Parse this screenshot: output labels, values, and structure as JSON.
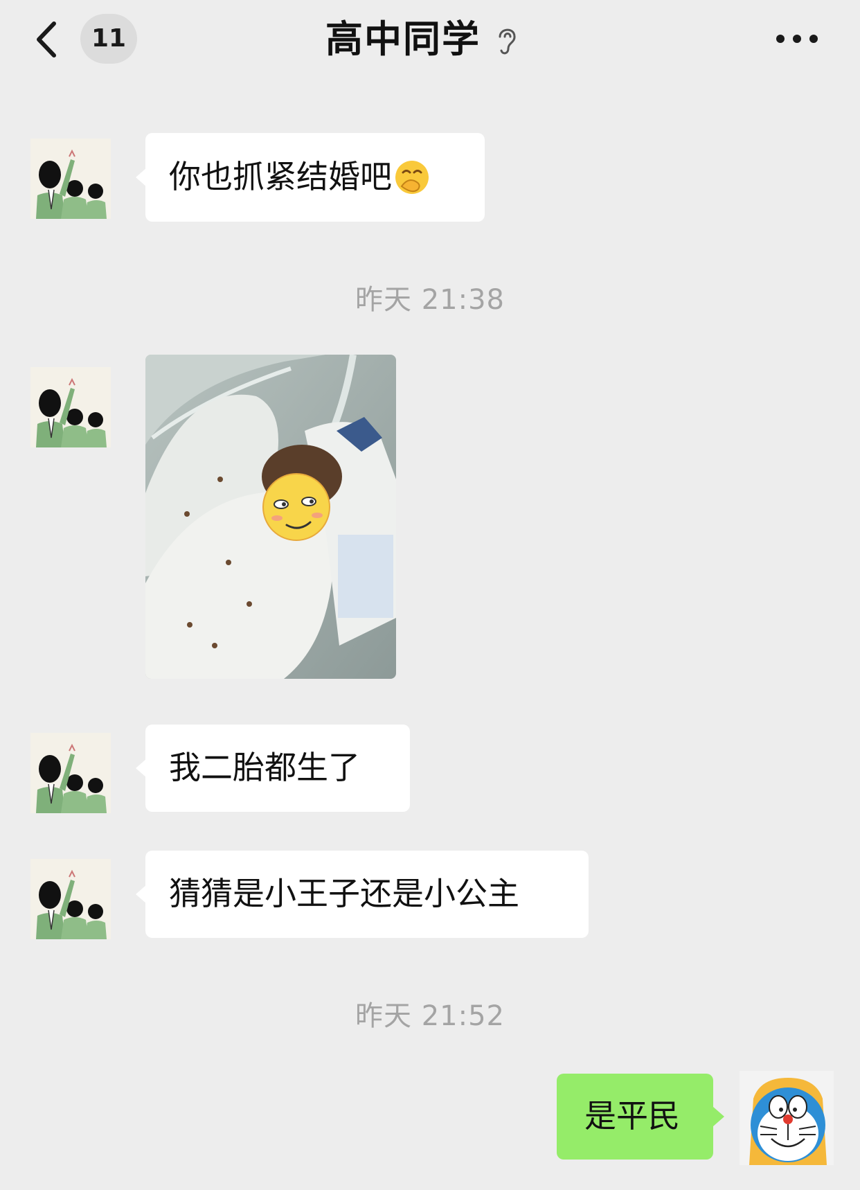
{
  "header": {
    "unread_count": "11",
    "title": "高中同学"
  },
  "messages": [
    {
      "side": "left",
      "type": "text",
      "text": "你也抓紧结婚吧",
      "emoji": "hand-over-mouth-emoji"
    },
    {
      "type": "timestamp",
      "text": "昨天 21:38"
    },
    {
      "side": "left",
      "type": "image",
      "subject": "newborn-baby-photo"
    },
    {
      "side": "left",
      "type": "text",
      "text": "我二胎都生了"
    },
    {
      "side": "left",
      "type": "text",
      "text": "猜猜是小王子还是小公主"
    },
    {
      "type": "timestamp",
      "text": "昨天 21:52"
    },
    {
      "side": "right",
      "type": "text",
      "text": "是平民"
    }
  ],
  "colors": {
    "background": "#ededed",
    "incoming_bubble": "#ffffff",
    "outgoing_bubble": "#95ec69",
    "timestamp_text": "#a4a4a4"
  }
}
